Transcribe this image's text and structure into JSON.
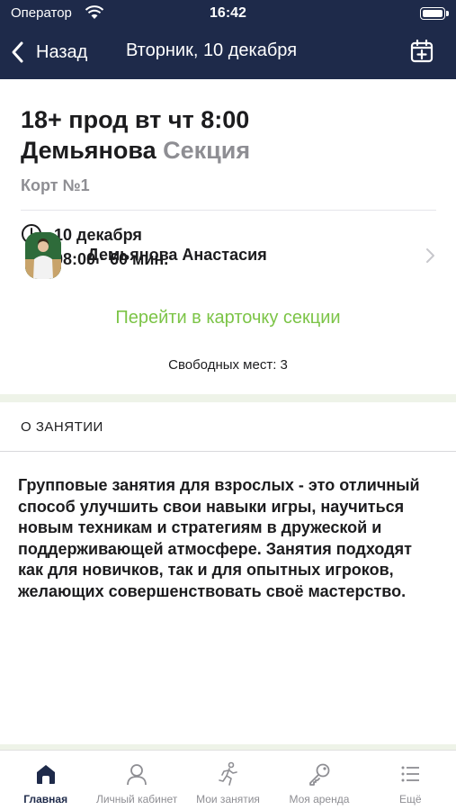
{
  "status_bar": {
    "carrier": "Оператор",
    "time": "16:42"
  },
  "nav": {
    "back_label": "Назад",
    "title": "Вторник, 10 декабря",
    "calendar_icon": "calendar-plus-icon"
  },
  "lesson": {
    "title_line1": "18+ прод вт чт 8:00",
    "trainer_short": "Демьянова",
    "kind": "Секция",
    "court": "Корт №1",
    "date": "10 декабря",
    "time_duration": "08:00 · 60 мин."
  },
  "trainer": {
    "name": "Демьянова Анастасия"
  },
  "section_link": "Перейти в карточку секции",
  "free_places": "Свободных мест: 3",
  "about": {
    "header": "О ЗАНЯТИИ",
    "text": "Групповые занятия для взрослых - это отличный способ улучшить свои навыки игры, научиться новым техникам и стратегиям в дружеской и поддерживающей атмосфере. Занятия подходят как для новичков, так и для опытных игроков, желающих совершенствовать своё мастерство."
  },
  "tabbar": {
    "items": [
      {
        "label": "Главная",
        "icon": "home-icon",
        "active": true
      },
      {
        "label": "Личный кабинет",
        "icon": "user-icon",
        "active": false
      },
      {
        "label": "Мои занятия",
        "icon": "runner-icon",
        "active": false
      },
      {
        "label": "Моя аренда",
        "icon": "key-icon",
        "active": false
      },
      {
        "label": "Ещё",
        "icon": "more-list-icon",
        "active": false
      }
    ]
  },
  "colors": {
    "header_bg": "#1e2a4a",
    "accent_green": "#7cc447",
    "secondary_text": "#8e8e93"
  }
}
